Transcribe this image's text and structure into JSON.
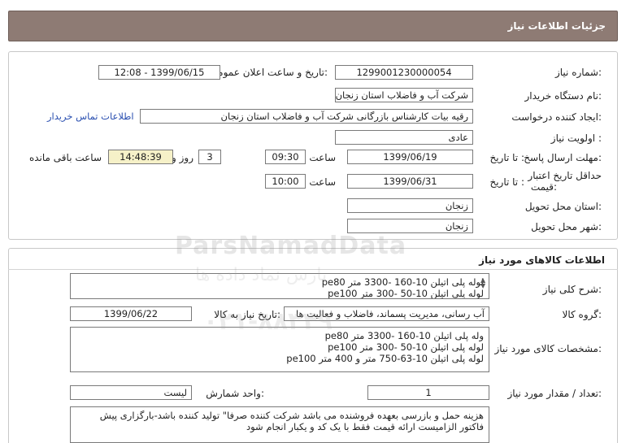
{
  "header": {
    "title": "جزئیات اطلاعات نیاز"
  },
  "need": {
    "number_label": "شماره نیاز:",
    "number_value": "1299001230000054",
    "announce_label": "تاریخ و ساعت اعلان عمومی:",
    "announce_value": "1399/06/15 - 12:08",
    "buyer_org_label": "نام دستگاه خریدار:",
    "buyer_org_value": "شرکت آب و فاضلاب استان زنجان",
    "requester_label": "ایجاد کننده درخواست:",
    "requester_value": "رقیه بیات کارشناس بازرگانی شرکت آب و فاضلاب استان زنجان",
    "contact_link": "اطلاعات تماس خریدار",
    "priority_label": "اولویت نیاز :",
    "priority_value": "عادی",
    "deadline_label": "مهلت ارسال پاسخ:",
    "to_date_label": "تا تاریخ :",
    "deadline_date": "1399/06/19",
    "time_label": "ساعت",
    "deadline_time": "09:30",
    "days_value": "3",
    "days_label": "روز و",
    "remaining_time": "14:48:39",
    "remaining_label": "ساعت باقی مانده",
    "validity_label_1": "حداقل تاریخ اعتبار",
    "validity_label_2": "قیمت:",
    "validity_to_label": "تا تاریخ :",
    "validity_date": "1399/06/31",
    "validity_time_label": "ساعت",
    "validity_time": "10:00",
    "province_label": "استان محل تحویل:",
    "province_value": "زنجان",
    "city_label": "شهر محل تحویل:",
    "city_value": "زنجان"
  },
  "goods": {
    "section_title": "اطلاعات کالاهای مورد نیاز",
    "summary_label": "شرح کلی نیاز:",
    "summary_lines": [
      "لوله پلی اتیلن 10-160 -3300 متر pe80",
      "لوله پلی اتیلن 10-50 -300 متر pe100"
    ],
    "group_label": "گروه کالا:",
    "group_value": "آب رسانی، مدیریت پسماند، فاضلاب و فعالیت ها",
    "need_date_label": "تاریخ نیاز به کالا:",
    "need_date_value": "1399/06/22",
    "spec_label": "مشخصات کالای مورد نیاز:",
    "spec_lines": [
      "وله پلی اتیلن 10-160 -3300 متر pe80",
      "لوله پلی اتیلن 10-50 -300 متر pe100",
      "لوله پلی اتیلن 10-63-750 متر و 400 متر pe100"
    ],
    "qty_label": "تعداد / مقدار مورد نیاز:",
    "qty_value": "1",
    "unit_label": "واحد شمارش:",
    "unit_value": "لیست",
    "notes_lines": [
      "هزینه حمل و بازرسی بعهده فروشنده می باشد شرکت کننده صرفا\" تولید کننده باشد-بارگزاری پیش",
      "فاکتور الزامیست ارائه قیمت فقط با یک کد و یکبار انجام شود"
    ]
  },
  "watermark": {
    "brand": "ParsNamadData",
    "brand_fa": "پارس نماد داده ها",
    "phone": "۰۲۱-۸۸۳۴۹"
  }
}
